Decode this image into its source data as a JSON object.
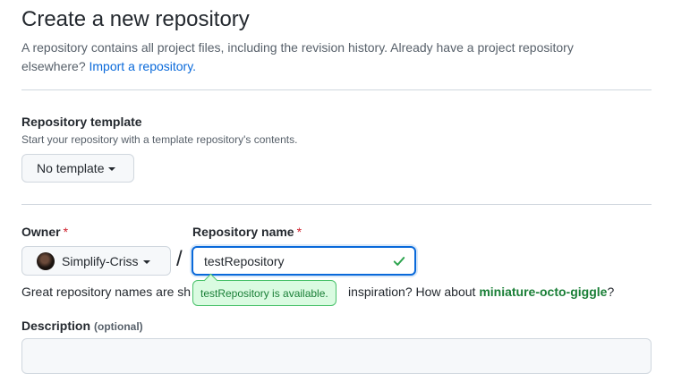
{
  "page": {
    "title": "Create a new repository",
    "intro_text": "A repository contains all project files, including the revision history. Already have a project repository elsewhere?",
    "import_link": "Import a repository."
  },
  "template": {
    "label": "Repository template",
    "note": "Start your repository with a template repository's contents.",
    "button": "No template"
  },
  "owner": {
    "label": "Owner",
    "required": "*",
    "value": "Simplify-Criss"
  },
  "separator": "/",
  "repo_name": {
    "label": "Repository name",
    "required": "*",
    "value": "testRepository",
    "status_icon": "check-icon"
  },
  "availability": {
    "message": "testRepository is available.",
    "hint_prefix": "Great repository names are sh",
    "hint_suffix": "inspiration? How about",
    "suggestion": "miniature-octo-giggle",
    "suggestion_end": "?"
  },
  "description": {
    "label": "Description",
    "optional": "(optional)",
    "value": ""
  },
  "colors": {
    "link": "#0969da",
    "success": "#1a7f37",
    "required": "#cf222e"
  }
}
